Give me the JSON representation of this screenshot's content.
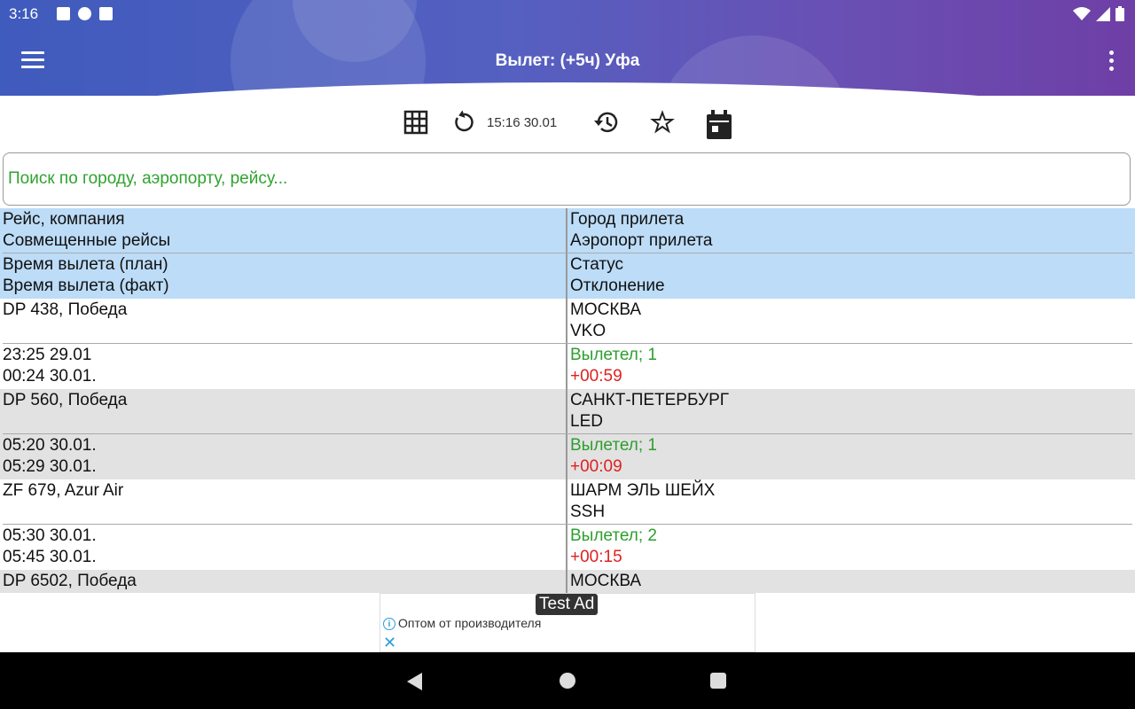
{
  "status_bar": {
    "time": "3:16"
  },
  "app_bar": {
    "title": "Вылет: (+5ч) Уфа"
  },
  "toolbar": {
    "updated": "15:16 30.01"
  },
  "search": {
    "placeholder": "Поиск по городу, аэропорту, рейсу..."
  },
  "table": {
    "header": [
      {
        "left": [
          "Рейс, компания",
          "Совмещенные рейсы"
        ],
        "right": [
          "Город прилета",
          "Аэропорт прилета"
        ]
      },
      {
        "left": [
          "Время вылета (план)",
          "Время вылета (факт)"
        ],
        "right": [
          "Статус",
          "Отклонение"
        ]
      }
    ],
    "flights": [
      {
        "flight": "DP 438, Победа",
        "city": "МОСКВА",
        "airport": "VKO",
        "planned": "23:25 29.01",
        "actual": "00:24 30.01.",
        "status": "Вылетел;  1",
        "deviation": "+00:59"
      },
      {
        "flight": "DP 560, Победа",
        "city": "САНКТ-ПЕТЕРБУРГ",
        "airport": "LED",
        "planned": "05:20 30.01.",
        "actual": "05:29 30.01.",
        "status": "Вылетел;  1",
        "deviation": "+00:09"
      },
      {
        "flight": "ZF 679, Azur Air",
        "city": "ШАРМ ЭЛЬ ШЕЙХ",
        "airport": "SSH",
        "planned": "05:30 30.01.",
        "actual": "05:45 30.01.",
        "status": "Вылетел;  2",
        "deviation": "+00:15"
      },
      {
        "flight": "DP 6502, Победа",
        "city": "МОСКВА"
      }
    ]
  },
  "ad": {
    "tag": "Test Ad",
    "text": "Оптом от производителя"
  },
  "colors": {
    "header_start": "#3f5bbd",
    "header_end": "#6e3fa6",
    "table_header": "#bcdcf7",
    "row_alt": "#e2e2e2",
    "status_ok": "#2e9e2e",
    "deviation": "#e02020"
  }
}
